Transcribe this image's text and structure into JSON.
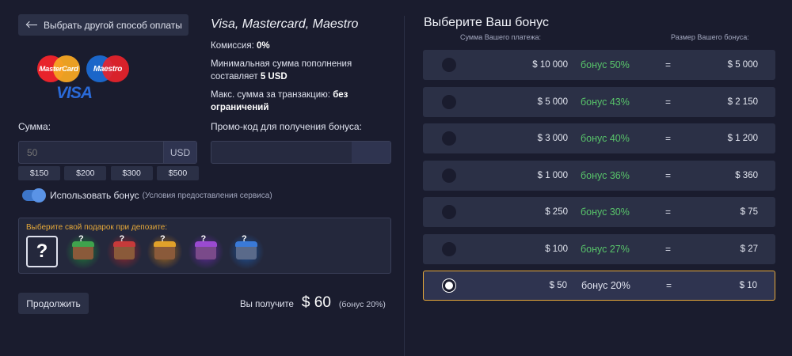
{
  "left": {
    "back_button": "Выбрать другой способ оплаты",
    "method_title": "Visa, Mastercard, Maestro",
    "logos": {
      "mastercard": "MasterCard",
      "maestro": "Maestro",
      "visa": "VISA"
    },
    "commission_label": "Комиссия:",
    "commission_value": "0%",
    "min_label": "Минимальная сумма пополнения составляет",
    "min_value": "5 USD",
    "max_label": "Макс. сумма за транзакцию:",
    "max_value": "без ограничений",
    "amount_label": "Сумма:",
    "amount_placeholder": "50",
    "currency": "USD",
    "presets": [
      "$150",
      "$200",
      "$300",
      "$500"
    ],
    "promo_label": "Промо-код для получения бонуса:",
    "use_bonus_label": "Использовать бонус",
    "use_bonus_terms": "(Условия предоставления сервиса)",
    "use_bonus_on": true,
    "gift_title": "Выберите свой подарок при депозите:",
    "gift_question": "?",
    "chest_mark": "?",
    "chests": [
      {
        "name": "green-chest-icon",
        "glow": "#1f8a3a",
        "box": "#8a5a3a",
        "lid": "#3fa34d"
      },
      {
        "name": "red-chest-icon",
        "glow": "#a8282c",
        "box": "#8a5a3a",
        "lid": "#c63a3a"
      },
      {
        "name": "gold-chest-icon",
        "glow": "#b8741a",
        "box": "#8a5a3a",
        "lid": "#e0a12a"
      },
      {
        "name": "purple-chest-icon",
        "glow": "#6a2aa8",
        "box": "#7a4a8a",
        "lid": "#9a4ad0"
      },
      {
        "name": "blue-chest-icon",
        "glow": "#1f5aa8",
        "box": "#5a6a8a",
        "lid": "#3a7ad8"
      }
    ],
    "continue_button": "Продолжить",
    "receive_label": "Вы получите",
    "receive_amount": "$ 60",
    "receive_bonus": "(бонус 20%)"
  },
  "right": {
    "title": "Выберите Ваш бонус",
    "col_payment": "Сумма Вашего платежа:",
    "col_bonus": "Размер Вашего бонуса:",
    "rows": [
      {
        "payment": "$ 10 000",
        "bonus": "бонус 50%",
        "eq": "=",
        "result": "$ 5 000",
        "selected": false
      },
      {
        "payment": "$ 5 000",
        "bonus": "бонус 43%",
        "eq": "=",
        "result": "$ 2 150",
        "selected": false
      },
      {
        "payment": "$ 3 000",
        "bonus": "бонус 40%",
        "eq": "=",
        "result": "$ 1 200",
        "selected": false
      },
      {
        "payment": "$ 1 000",
        "bonus": "бонус 36%",
        "eq": "=",
        "result": "$ 360",
        "selected": false
      },
      {
        "payment": "$ 250",
        "bonus": "бонус 30%",
        "eq": "=",
        "result": "$ 75",
        "selected": false
      },
      {
        "payment": "$ 100",
        "bonus": "бонус 27%",
        "eq": "=",
        "result": "$ 27",
        "selected": false
      },
      {
        "payment": "$ 50",
        "bonus": "бонус 20%",
        "eq": "=",
        "result": "$ 10",
        "selected": true
      }
    ]
  }
}
